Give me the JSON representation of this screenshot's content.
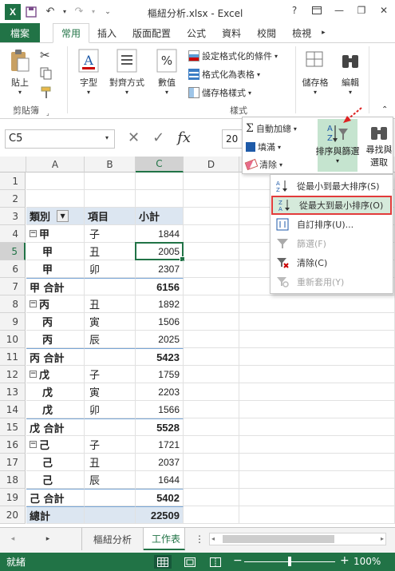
{
  "window": {
    "title": "樞紐分析.xlsx - Excel",
    "logo": "X",
    "undo_icon": "undo-icon",
    "redo_icon": "redo-icon",
    "help": "?",
    "minimize": "—",
    "restore": "❐",
    "close": "✕"
  },
  "tabs": [
    "檔案",
    "常用",
    "插入",
    "版面配置",
    "公式",
    "資料",
    "校閱",
    "檢視"
  ],
  "active_tab": "常用",
  "ribbon": {
    "paste": "貼上",
    "clipboard_group": "剪貼簿",
    "font": "字型",
    "alignment": "對齊方式",
    "number": "數值",
    "conditional_format": "設定格式化的條件",
    "format_as_table": "格式化為表格",
    "cell_styles": "儲存格樣式",
    "styles_group": "樣式",
    "cells": "儲存格",
    "editing": "編輯"
  },
  "formula_bar": {
    "name_box": "C5",
    "cancel": "✕",
    "enter": "✓",
    "fx": "fx",
    "value": "20"
  },
  "editing_panel": {
    "autosum": "自動加總",
    "fill": "填滿",
    "clear": "清除",
    "sort_filter": "排序與篩選",
    "find_select_1": "尋找與",
    "find_select_2": "選取"
  },
  "sort_menu": {
    "items": [
      {
        "label": "從最小到最大排序(S)",
        "enabled": true,
        "icon": "sort-asc-icon"
      },
      {
        "label": "從最大到最小排序(O)",
        "enabled": true,
        "icon": "sort-desc-icon",
        "highlighted": true
      },
      {
        "label": "自訂排序(U)...",
        "enabled": true,
        "icon": "custom-sort-icon"
      },
      {
        "label": "篩選(F)",
        "enabled": false,
        "icon": "filter-icon"
      },
      {
        "label": "清除(C)",
        "enabled": true,
        "icon": "clear-filter-icon"
      },
      {
        "label": "重新套用(Y)",
        "enabled": false,
        "icon": "reapply-icon"
      }
    ]
  },
  "columns": [
    "A",
    "B",
    "C",
    "D"
  ],
  "rows": [
    {
      "n": "1",
      "a": "",
      "b": "",
      "c": "",
      "kind": "empty"
    },
    {
      "n": "2",
      "a": "",
      "b": "",
      "c": "",
      "kind": "empty"
    },
    {
      "n": "3",
      "a": "類別",
      "b": "項目",
      "c": "小計",
      "kind": "header"
    },
    {
      "n": "4",
      "a": "甲",
      "b": "子",
      "c": "1844",
      "kind": "first"
    },
    {
      "n": "5",
      "a": "甲",
      "b": "丑",
      "c": "2005",
      "kind": "item"
    },
    {
      "n": "6",
      "a": "甲",
      "b": "卯",
      "c": "2307",
      "kind": "item"
    },
    {
      "n": "7",
      "a": "甲 合計",
      "b": "",
      "c": "6156",
      "kind": "total"
    },
    {
      "n": "8",
      "a": "丙",
      "b": "丑",
      "c": "1892",
      "kind": "first"
    },
    {
      "n": "9",
      "a": "丙",
      "b": "寅",
      "c": "1506",
      "kind": "item"
    },
    {
      "n": "10",
      "a": "丙",
      "b": "辰",
      "c": "2025",
      "kind": "item"
    },
    {
      "n": "11",
      "a": "丙 合計",
      "b": "",
      "c": "5423",
      "kind": "total"
    },
    {
      "n": "12",
      "a": "戊",
      "b": "子",
      "c": "1759",
      "kind": "first"
    },
    {
      "n": "13",
      "a": "戊",
      "b": "寅",
      "c": "2203",
      "kind": "item"
    },
    {
      "n": "14",
      "a": "戊",
      "b": "卯",
      "c": "1566",
      "kind": "item"
    },
    {
      "n": "15",
      "a": "戊 合計",
      "b": "",
      "c": "5528",
      "kind": "total"
    },
    {
      "n": "16",
      "a": "己",
      "b": "子",
      "c": "1721",
      "kind": "first"
    },
    {
      "n": "17",
      "a": "己",
      "b": "丑",
      "c": "2037",
      "kind": "item"
    },
    {
      "n": "18",
      "a": "己",
      "b": "辰",
      "c": "1644",
      "kind": "item"
    },
    {
      "n": "19",
      "a": "己 合計",
      "b": "",
      "c": "5402",
      "kind": "total"
    },
    {
      "n": "20",
      "a": "總計",
      "b": "",
      "c": "22509",
      "kind": "grand"
    }
  ],
  "selected_cell": {
    "col": "C",
    "row": "5"
  },
  "sheet_tabs": [
    "樞紐分析",
    "工作表"
  ],
  "active_sheet": "工作表",
  "status": {
    "ready": "就緒",
    "zoom": "100%",
    "minus": "−",
    "plus": "+"
  },
  "colors": {
    "excel_green": "#217346",
    "pivot_header": "#dce6f1",
    "highlight_red": "#e23b3b"
  }
}
